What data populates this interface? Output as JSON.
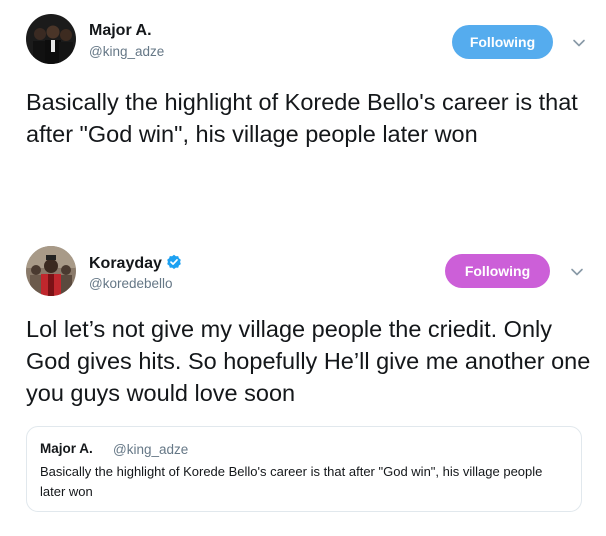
{
  "tweets": [
    {
      "display_name": "Major A.",
      "handle": "@king_adze",
      "follow_label": "Following",
      "follow_color": "#55acee",
      "text": "Basically the highlight of Korede Bello's career is that after \"God win\", his village people later won",
      "icons": {
        "more": "chevron-down-icon"
      }
    },
    {
      "display_name": "Korayday",
      "handle": "@koredebello",
      "verified": true,
      "verified_color": "#1da1f2",
      "follow_label": "Following",
      "follow_color": "#cc5fd8",
      "text": "Lol let’s not give my village people the criedit. Only God gives hits. So hopefully He’ll give me another one you guys would love soon",
      "icons": {
        "verified": "verified-badge-icon",
        "more": "chevron-down-icon"
      }
    }
  ],
  "quoted_tweet": {
    "display_name": "Major A.",
    "handle": "@king_adze",
    "text": "Basically the highlight of Korede Bello's career is that after \"God win\", his village people later won"
  }
}
